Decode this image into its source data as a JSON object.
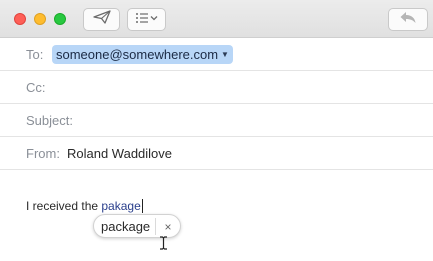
{
  "toolbar": {
    "buttons": [
      "send",
      "format",
      "reply"
    ],
    "icons": {
      "send": "paper-plane-icon",
      "format": "list-icon",
      "reply": "reply-arrow-icon"
    }
  },
  "header": {
    "to_label": "To:",
    "to_recipient": "someone@somewhere.com",
    "cc_label": "Cc:",
    "subject_label": "Subject:",
    "from_label": "From:",
    "from_value": "Roland Waddilove"
  },
  "body": {
    "text_prefix": "I received the ",
    "misspelled_word": "pakage"
  },
  "spelling_suggestion": {
    "suggestion": "package",
    "dismiss_glyph": "×"
  },
  "colors": {
    "token_bg": "#b8d6f7",
    "close": "#fe5f57",
    "minimize": "#febc2e",
    "maximize": "#28c840"
  }
}
